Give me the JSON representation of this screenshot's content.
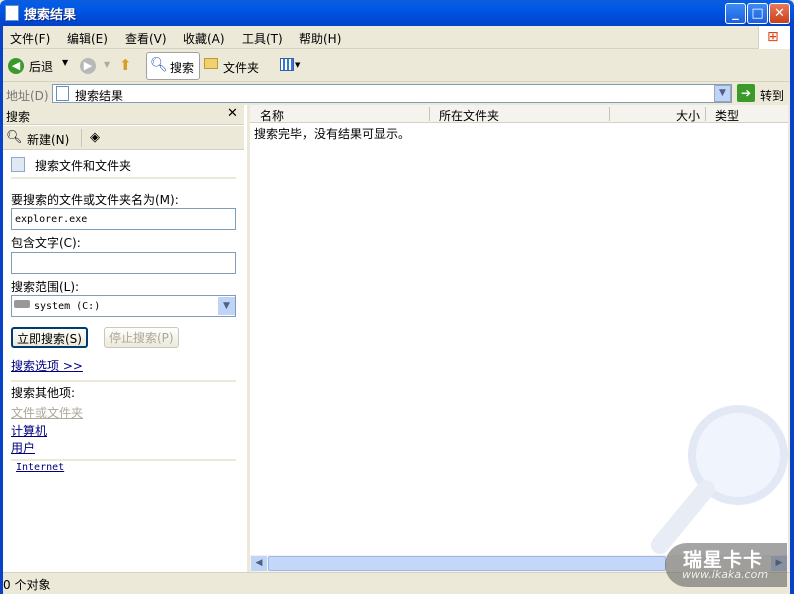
{
  "window": {
    "title": "搜索结果"
  },
  "menu": [
    "文件(F)",
    "编辑(E)",
    "查看(V)",
    "收藏(A)",
    "工具(T)",
    "帮助(H)"
  ],
  "toolbar": {
    "back": "后退",
    "search": "搜索",
    "folders": "文件夹"
  },
  "address": {
    "label": "地址(D)",
    "value": "搜索结果",
    "go": "转到"
  },
  "search_pane": {
    "title": "搜索",
    "new": "新建(N)",
    "heading": "搜索文件和文件夹",
    "name_label": "要搜索的文件或文件夹名为(M):",
    "name_value": "explorer.exe",
    "text_label": "包含文字(C):",
    "text_value": "",
    "scope_label": "搜索范围(L):",
    "scope_value": "system (C:)",
    "search_now": "立即搜索(S)",
    "stop": "停止搜索(P)",
    "options": "搜索选项 >>",
    "other_label": "搜索其他项:",
    "other": [
      "文件或文件夹",
      "计算机",
      "用户"
    ],
    "internet": "Internet"
  },
  "results": {
    "columns": [
      "名称",
      "所在文件夹",
      "大小",
      "类型"
    ],
    "message": "搜索完毕，没有结果可显示。"
  },
  "status": {
    "count": "0 个对象"
  },
  "watermark": {
    "brand": "瑞星卡卡",
    "url": "www.ikaka.com"
  }
}
